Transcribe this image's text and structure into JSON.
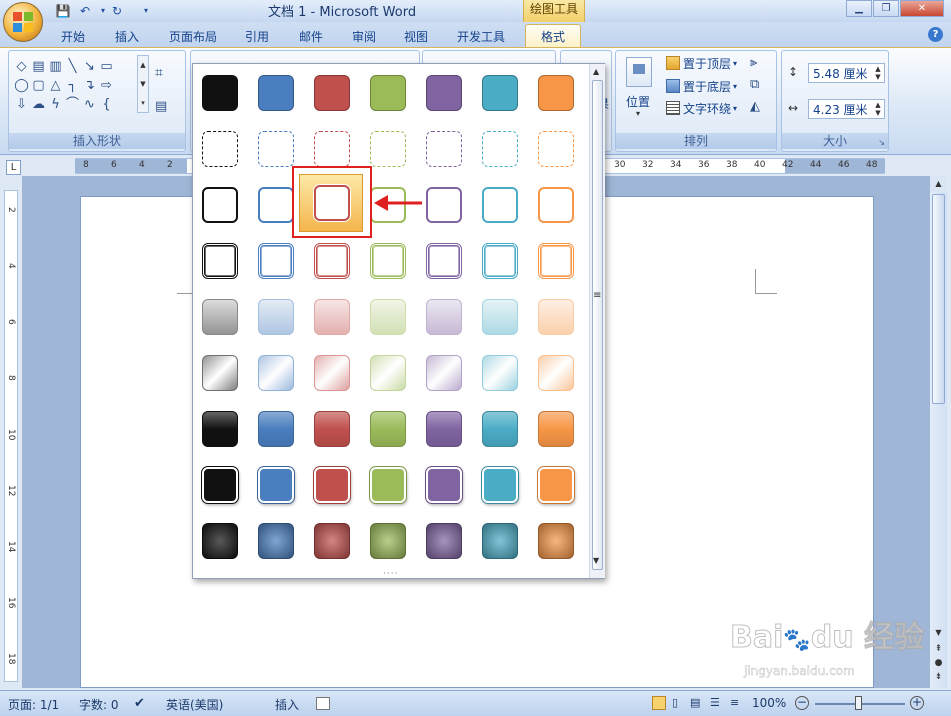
{
  "titlebar": {
    "doc_title": "文档 1 - Microsoft Word",
    "context_tab_group": "绘图工具",
    "minimize_icon": "minimize-icon",
    "restore_icon": "restore-icon",
    "close_icon": "close-icon"
  },
  "quick_access": {
    "save_icon": "save-icon",
    "undo_icon": "undo-icon",
    "redo_icon": "redo-icon",
    "customize_icon": "dropdown-icon"
  },
  "tabs": [
    {
      "label": "开始"
    },
    {
      "label": "插入"
    },
    {
      "label": "页面布局"
    },
    {
      "label": "引用"
    },
    {
      "label": "邮件"
    },
    {
      "label": "审阅"
    },
    {
      "label": "视图"
    },
    {
      "label": "开发工具"
    },
    {
      "label": "格式",
      "active": true
    }
  ],
  "ribbon": {
    "insert_shapes_label": "插入形状",
    "arrange": {
      "position_label": "位置",
      "bring_front_label": "置于顶层",
      "send_back_label": "置于底层",
      "text_wrap_label": "文字环绕",
      "group_label": "排列"
    },
    "size": {
      "height_value": "5.48 厘米",
      "width_value": "4.23 厘米",
      "group_label": "大小"
    },
    "partial_label": "果"
  },
  "ruler": {
    "h_left_ticks": [
      "8",
      "6",
      "4",
      "2"
    ],
    "h_right_ticks": [
      "30",
      "32",
      "34",
      "36",
      "38",
      "40",
      "42",
      "44",
      "46",
      "48"
    ],
    "v_ticks": [
      "2",
      "4",
      "6",
      "8",
      "10",
      "12",
      "14",
      "16",
      "18"
    ]
  },
  "gallery": {
    "colors": {
      "black": "#111111",
      "blue": "#4a7ebf",
      "red": "#c0504d",
      "green": "#9bbb59",
      "purple": "#8064a2",
      "aqua": "#4bacc6",
      "orange": "#f79646"
    },
    "rows": 9,
    "columns": 7,
    "selected_cell": "row 3, column 3"
  },
  "statusbar": {
    "page": "页面: 1/1",
    "words": "字数: 0",
    "language": "英语(美国)",
    "insert_mode": "插入",
    "zoom": "100%"
  },
  "watermark": {
    "url": "jingyan.baidu.com"
  }
}
